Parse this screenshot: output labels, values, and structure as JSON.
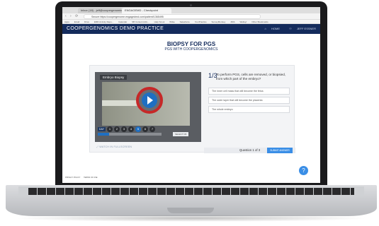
{
  "browser": {
    "tabs": [
      {
        "label": "Inbox (18) - jeff@coopergenomics"
      },
      {
        "label": "ENGAGEMD - Checkpoint"
      }
    ],
    "url": "Secure https://coopergenome.engagedmd.com/patient/1365495",
    "bookmarks": [
      "Apps",
      "Email",
      "Drive",
      "EMD Activity Repo...",
      "Calendar",
      "SB Content Adm...",
      "Help Scout",
      "Wrike",
      "Salesforce",
      "YourPractice",
      "SurveyMonkey",
      "JIRA",
      "Welloyr",
      "Other Bookmarks"
    ]
  },
  "header": {
    "title": "COOPERGENOMICS DEMO PRACTICE",
    "home_label": "HOME",
    "user_label": "JEFF ESSNER"
  },
  "page": {
    "title": "BIOPSY FOR PGS",
    "subtitle": "PGS WITH COOPERGENOMICS"
  },
  "video": {
    "label": "Embryo Biopsy",
    "day_label": "DAY",
    "days": [
      "1",
      "2",
      "3",
      "4",
      "5",
      "6",
      "7"
    ],
    "active_day_index": 4,
    "progress": 0.18,
    "hint": "SELECT D5"
  },
  "watch_label": "WATCH IN FULLSCREEN",
  "question": {
    "number": "1/3",
    "text": "To perform PGS, cells are removed, or biopsied, from which part of the embryo?",
    "options": [
      "The inner cell mass that will become the fetus",
      "The outer layer that will become the placenta",
      "The whole embryo"
    ],
    "counter": "Question 1 of 3",
    "submit_label": "SUBMIT ANSWER"
  },
  "help_label": "?",
  "footer": {
    "links": [
      "PRIVACY POLICY",
      "TERMS OF USE"
    ]
  },
  "colors": {
    "brand_navy": "#142b5c",
    "accent_blue": "#3a8ee6",
    "ring_red": "#c62828"
  }
}
